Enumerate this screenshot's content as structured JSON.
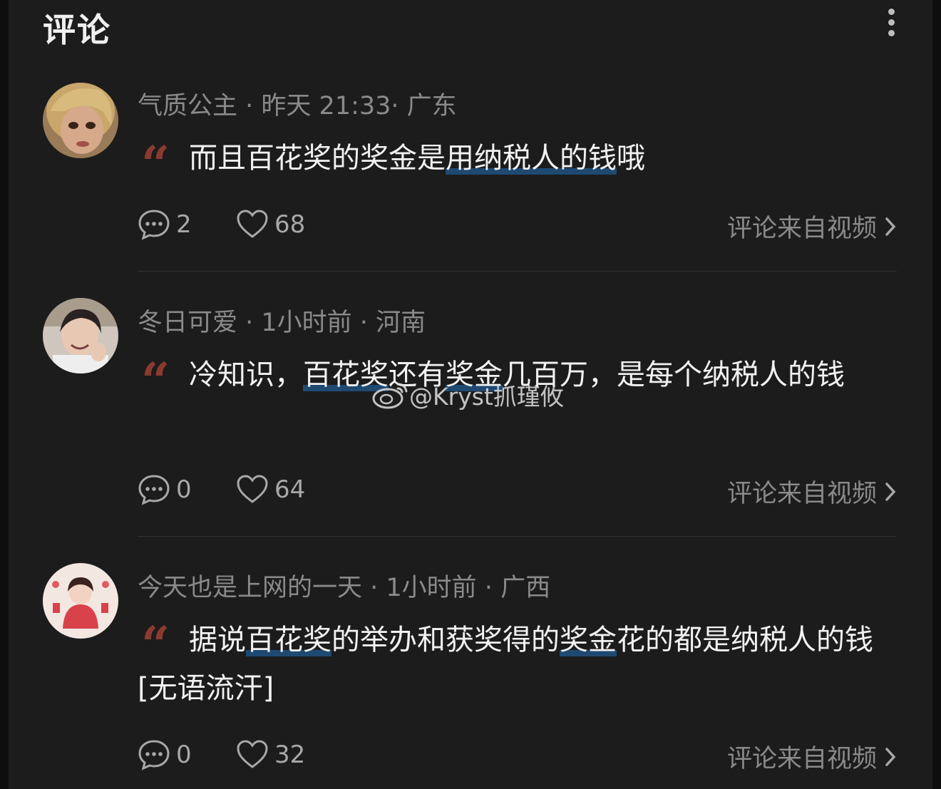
{
  "header": {
    "title": "评论"
  },
  "comments": [
    {
      "username": "气质公主",
      "time": "昨天 21:33",
      "region": "广东",
      "text_parts": [
        "而且百花奖的奖金是",
        "用纳税人的钱",
        "哦"
      ],
      "reply_count": "2",
      "like_count": "68",
      "source_label": "评论来自视频"
    },
    {
      "username": "冬日可爱",
      "time": "1小时前",
      "region": "河南",
      "text_parts": [
        "冷知识，",
        "百花奖",
        "还有",
        "奖金",
        "几百万，是每个纳税人的钱"
      ],
      "reply_count": "0",
      "like_count": "64",
      "source_label": "评论来自视频"
    },
    {
      "username": "今天也是上网的一天",
      "time": "1小时前",
      "region": "广西",
      "text_parts": [
        "据说",
        "百花奖",
        "的举办和获奖得的",
        "奖金",
        "花的都是纳税人的钱[无语流汗]"
      ],
      "reply_count": "0",
      "like_count": "32",
      "source_label": "评论来自视频"
    }
  ],
  "watermark": {
    "text": "@Kryst抓瑾攸"
  },
  "colors": {
    "background": "#1c1c1c",
    "highlight_underline": "#1e4a72",
    "quote": "#8b3a30"
  }
}
